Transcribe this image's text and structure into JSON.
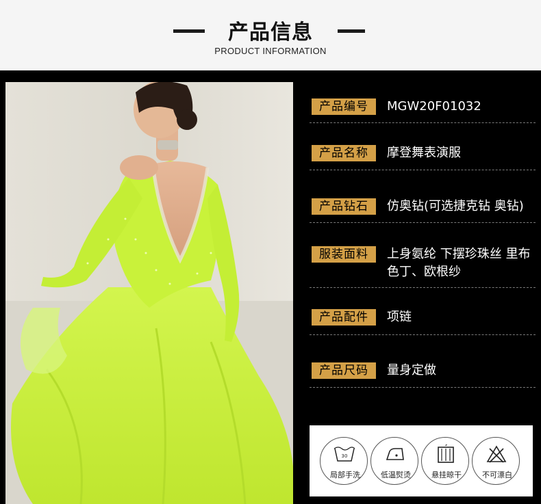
{
  "header": {
    "title": "产品信息",
    "subtitle": "PRODUCT INFORMATION"
  },
  "photo": {
    "description_icon": "dress-model-photo"
  },
  "specs": [
    {
      "label": "产品编号",
      "value": "MGW20F01032"
    },
    {
      "label": "产品名称",
      "value": "摩登舞表演服"
    },
    {
      "label": "产品钻石",
      "value": "仿奥钻(可选捷克钻 奥钻)"
    },
    {
      "label": "服装面料",
      "value": "上身氨纶 下摆珍珠丝 里布色丁、欧根纱"
    },
    {
      "label": "产品配件",
      "value": "项链"
    },
    {
      "label": "产品尺码",
      "value": "量身定做"
    }
  ],
  "care": [
    {
      "icon": "hand-wash-30-icon",
      "label": "局部手洗"
    },
    {
      "icon": "low-iron-icon",
      "label": "低温熨烫"
    },
    {
      "icon": "hang-dry-icon",
      "label": "悬挂晾干"
    },
    {
      "icon": "no-bleach-icon",
      "label": "不可漂白"
    }
  ],
  "colors": {
    "gold": "#d4a047",
    "dress": "#c9f23a",
    "background": "#000000"
  }
}
